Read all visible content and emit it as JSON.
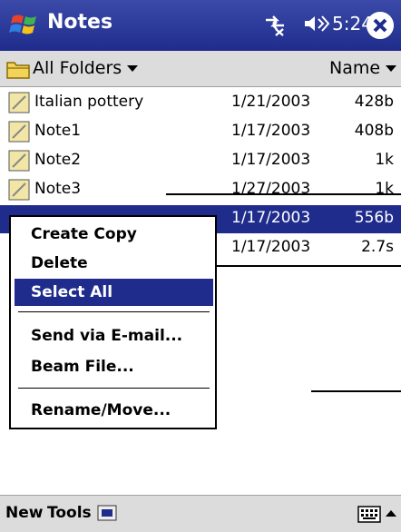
{
  "title_bar": {
    "app_title": "Notes",
    "time": "5:24"
  },
  "header": {
    "folder_label": "All Folders",
    "sort_label": "Name"
  },
  "files": [
    {
      "name": "Italian pottery",
      "date": "1/21/2003",
      "size": "428b"
    },
    {
      "name": "Note1",
      "date": "1/17/2003",
      "size": "408b"
    },
    {
      "name": "Note2",
      "date": "1/17/2003",
      "size": "1k"
    },
    {
      "name": "Note3",
      "date": "1/27/2003",
      "size": "1k"
    },
    {
      "name": "",
      "date": "1/17/2003",
      "size": "556b"
    },
    {
      "name": "",
      "date": "1/17/2003",
      "size": "2.7s"
    }
  ],
  "context_menu": {
    "items": [
      "Create Copy",
      "Delete",
      "Select All",
      "Send via E-mail...",
      "Beam File...",
      "Rename/Move..."
    ],
    "active_item": "Select All"
  },
  "bottom_bar": {
    "new_label": "New",
    "tools_label": "Tools"
  },
  "colors": {
    "title_bar": "#1f2c8c",
    "selection": "#1f2c8c",
    "bar_gray": "#dcdcdc"
  }
}
